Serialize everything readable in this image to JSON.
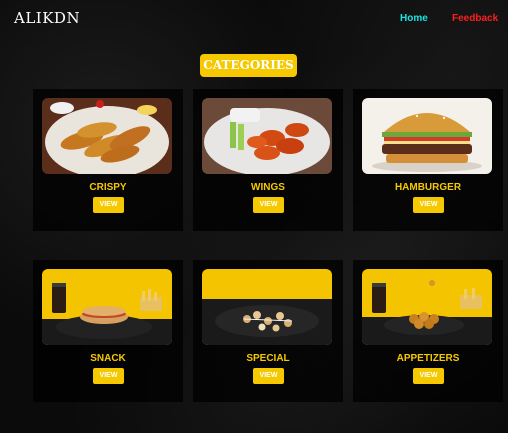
{
  "header": {
    "brand": "ALIKDN",
    "nav": {
      "home": "Home",
      "feedback": "Feedback"
    }
  },
  "section": {
    "title": "CATEGORIES"
  },
  "categories": [
    {
      "name": "CRISPY",
      "button": "VIEW"
    },
    {
      "name": "WINGS",
      "button": "VIEW"
    },
    {
      "name": "HAMBURGER",
      "button": "VIEW"
    },
    {
      "name": "SNACK",
      "button": "VIEW"
    },
    {
      "name": "SPECIAL",
      "button": "VIEW"
    },
    {
      "name": "APPETIZERS",
      "button": "VIEW"
    }
  ],
  "colors": {
    "accent": "#f5c800",
    "home_link": "#19e3e3",
    "feedback_link": "#ff1f1f"
  }
}
